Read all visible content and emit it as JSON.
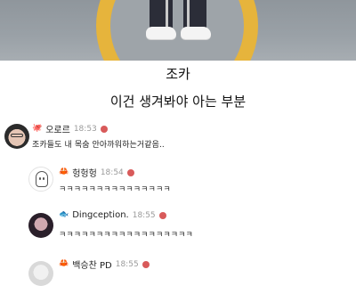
{
  "post": {
    "caption_main": "조카",
    "caption_sub": "이건 생겨봐야 아는 부분"
  },
  "comments": [
    {
      "name": "오로르",
      "badge": "🐙",
      "time": "18:53",
      "text": "조카들도 내 목숨 안아까워하는거같음..",
      "avatar": "person-with-glasses"
    },
    {
      "name": "헝헝헝",
      "badge": "🦀",
      "time": "18:54",
      "text": "ㅋㅋㅋㅋㅋㅋㅋㅋㅋㅋㅋㅋㅋㅋㅋ",
      "avatar": "ghost"
    },
    {
      "name": "Dingception.",
      "badge": "🐟",
      "time": "18:55",
      "text": "ㅋㅋㅋㅋㅋㅋㅋㅋㅋㅋㅋㅋㅋㅋㅋㅋㅋㅋ",
      "avatar": "photo"
    },
    {
      "name": "백승찬 PD",
      "badge": "🦀",
      "time": "18:55",
      "text": "",
      "avatar": "photo2"
    }
  ],
  "colors": {
    "accent_dot": "#d85a5a",
    "muted_text": "#9a9a9a"
  }
}
